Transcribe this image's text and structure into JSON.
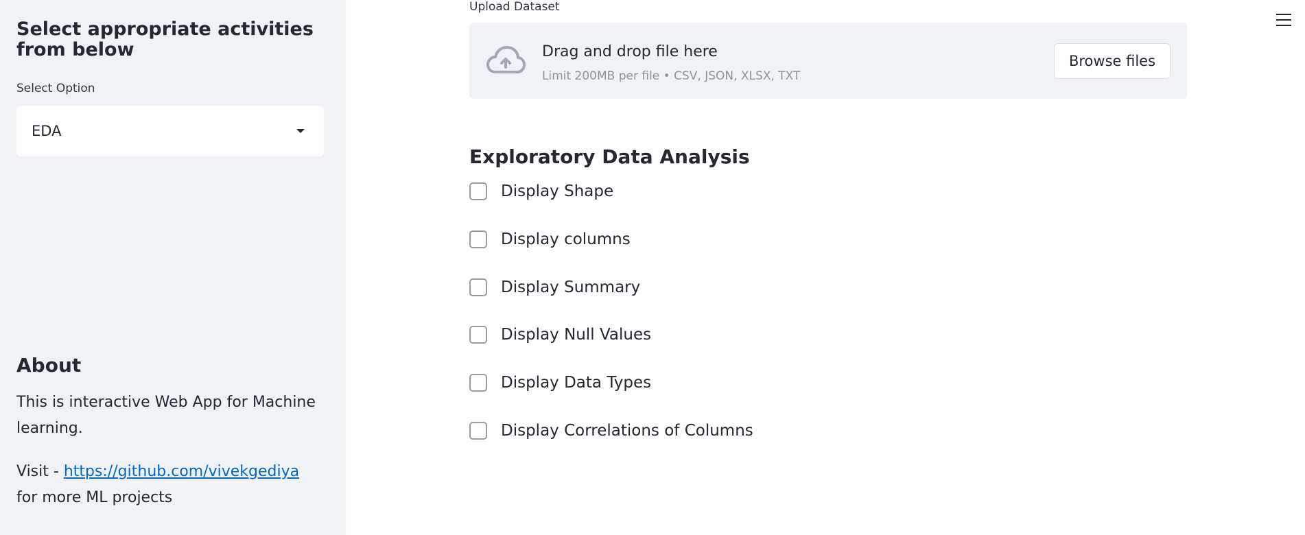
{
  "sidebar": {
    "heading": "Select appropriate activities from below",
    "select_label": "Select Option",
    "select_value": "EDA",
    "about_title": "About",
    "about_text": "This is interactive Web App for Machine learning.",
    "visit_prefix": "Visit - ",
    "visit_link": "https://github.com/vivekgediya",
    "visit_suffix": " for more ML projects"
  },
  "main": {
    "upload_label": "Upload Dataset",
    "drop_title": "Drag and drop file here",
    "drop_subtitle": "Limit 200MB per file • CSV, JSON, XLSX, TXT",
    "browse_label": "Browse files",
    "section_title": "Exploratory Data Analysis",
    "checkboxes": [
      {
        "label": "Display Shape",
        "checked": false
      },
      {
        "label": "Display columns",
        "checked": false
      },
      {
        "label": "Display Summary",
        "checked": false
      },
      {
        "label": "Display Null Values",
        "checked": false
      },
      {
        "label": "Display Data Types",
        "checked": false
      },
      {
        "label": "Display Correlations of Columns",
        "checked": false
      }
    ]
  },
  "icons": {
    "upload": "cloud-upload-icon",
    "menu": "hamburger-menu-icon",
    "select_caret": "caret-down-icon"
  },
  "colors": {
    "sidebar_bg": "#f0f2f6",
    "link": "#0068c9",
    "text": "#262730"
  }
}
